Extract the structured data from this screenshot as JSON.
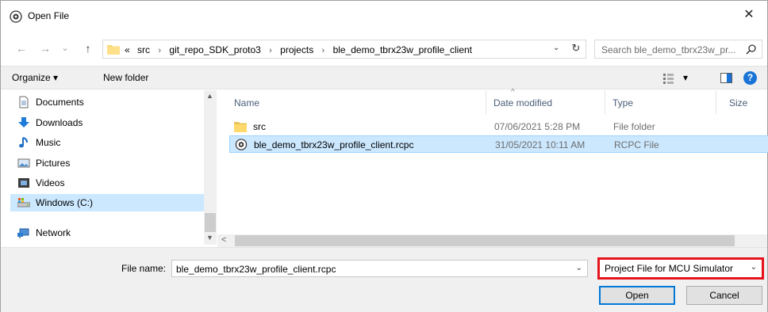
{
  "window": {
    "title": "Open File",
    "close_glyph": "✕"
  },
  "nav_buttons": {
    "back": "←",
    "forward": "→",
    "recent": "⌄",
    "up": "↑"
  },
  "address": {
    "prefix": "«",
    "crumbs": [
      "src",
      "git_repo_SDK_proto3",
      "projects",
      "ble_demo_tbrx23w_profile_client"
    ],
    "separator": "›",
    "dropdown_glyph": "⌄",
    "refresh_glyph": "↻"
  },
  "search": {
    "placeholder": "Search ble_demo_tbrx23w_pr..."
  },
  "toolbar": {
    "organize": "Organize ▾",
    "new_folder": "New folder",
    "view_caret": "▾",
    "help": "?"
  },
  "nav_pane": {
    "items": [
      {
        "label": "Documents",
        "icon": "documents-icon"
      },
      {
        "label": "Downloads",
        "icon": "downloads-icon"
      },
      {
        "label": "Music",
        "icon": "music-icon"
      },
      {
        "label": "Pictures",
        "icon": "pictures-icon"
      },
      {
        "label": "Videos",
        "icon": "videos-icon"
      },
      {
        "label": "Windows (C:)",
        "icon": "drive-icon",
        "selected": true
      },
      {
        "label": "Network",
        "icon": "network-icon"
      }
    ]
  },
  "columns": {
    "name": "Name",
    "date": "Date modified",
    "type": "Type",
    "size": "Size",
    "sort_glyph": "^"
  },
  "files": [
    {
      "name": "src",
      "date": "07/06/2021 5:28 PM",
      "type": "File folder",
      "icon": "folder-icon",
      "selected": false
    },
    {
      "name": "ble_demo_tbrx23w_profile_client.rcpc",
      "date": "31/05/2021 10:11 AM",
      "type": "RCPC File",
      "icon": "rcpc-file-icon",
      "selected": true
    }
  ],
  "bottom": {
    "file_name_label": "File name:",
    "file_name_value": "ble_demo_tbrx23w_profile_client.rcpc",
    "filter_value": "Project File for MCU Simulator",
    "dropdown_glyph": "⌄",
    "open_label": "Open",
    "cancel_label": "Cancel"
  },
  "colors": {
    "selection": "#cce8ff",
    "highlight_border": "#e5141c",
    "accent": "#0078d7"
  }
}
